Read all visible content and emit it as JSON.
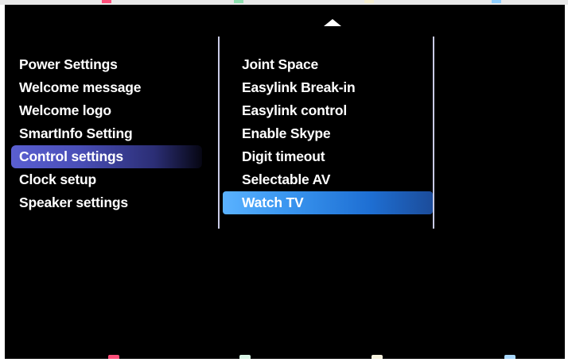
{
  "colors": {
    "background": "#000000",
    "text": "#ffffff",
    "left_highlight": "#4a4fb8",
    "right_highlight": "#3a96f0",
    "divider": "#c9cbe6"
  },
  "navigation": {
    "up_icon": "triangle-up-icon"
  },
  "left_menu": {
    "items": [
      {
        "label": "Power Settings"
      },
      {
        "label": "Welcome message"
      },
      {
        "label": "Welcome logo"
      },
      {
        "label": "SmartInfo Setting"
      },
      {
        "label": "Control settings",
        "selected": true
      },
      {
        "label": "Clock setup"
      },
      {
        "label": "Speaker settings"
      }
    ]
  },
  "right_menu": {
    "items": [
      {
        "label": "Joint Space"
      },
      {
        "label": "Easylink Break-in"
      },
      {
        "label": "Easylink control"
      },
      {
        "label": "Enable Skype"
      },
      {
        "label": "Digit timeout"
      },
      {
        "label": "Selectable AV"
      },
      {
        "label": "Watch TV",
        "selected": true
      }
    ]
  },
  "color_keys": [
    {
      "name": "red",
      "color": "#ff4f7a"
    },
    {
      "name": "green",
      "color": "#d9f5e6"
    },
    {
      "name": "yellow",
      "color": "#f7f3df"
    },
    {
      "name": "blue",
      "color": "#a9d9ff"
    }
  ]
}
